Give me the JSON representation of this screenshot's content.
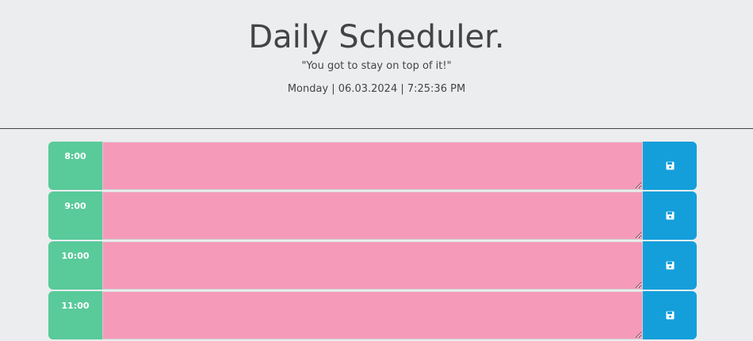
{
  "header": {
    "title": "Daily Scheduler.",
    "tagline": "\"You got to stay on top of it!\"",
    "current_date": "Monday | 06.03.2024 | 7:25:36 PM"
  },
  "schedule": {
    "rows": [
      {
        "hour": "8:00",
        "text": "",
        "save_icon": "floppy-disk-icon"
      },
      {
        "hour": "9:00",
        "text": "",
        "save_icon": "floppy-disk-icon"
      },
      {
        "hour": "10:00",
        "text": "",
        "save_icon": "floppy-disk-icon"
      },
      {
        "hour": "11:00",
        "text": "",
        "save_icon": "floppy-disk-icon"
      }
    ]
  },
  "colors": {
    "hour_block": "#59ca9a",
    "description_future": "#f59bb9",
    "save_button": "#149fdb",
    "background": "#ebedef"
  }
}
